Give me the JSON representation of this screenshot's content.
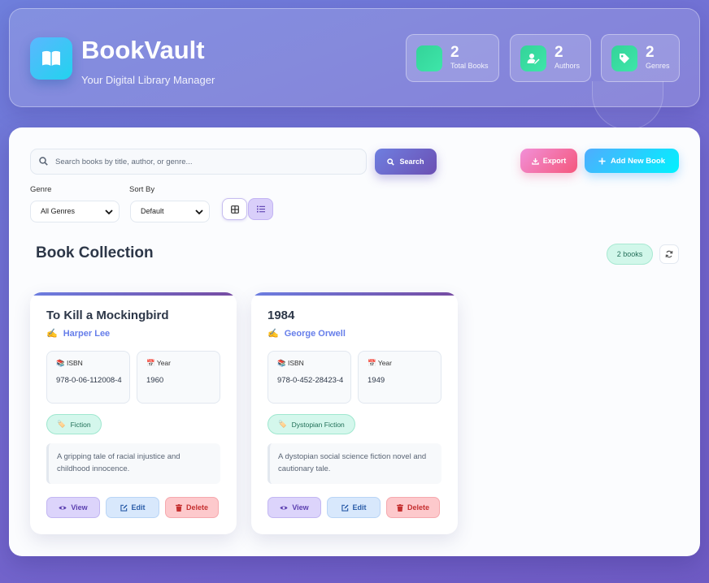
{
  "header": {
    "title": "BookVault",
    "subtitle": "Your Digital Library Manager",
    "stats": [
      {
        "value": "2",
        "label": "Total Books",
        "icon": "blank-icon"
      },
      {
        "value": "2",
        "label": "Authors",
        "icon": "user-edit-icon"
      },
      {
        "value": "2",
        "label": "Genres",
        "icon": "tag-icon"
      }
    ]
  },
  "toolbar": {
    "search_placeholder": "Search books by title, author, or genre...",
    "search_label": "Search",
    "export_label": "Export",
    "add_label": "Add New Book"
  },
  "filters": {
    "genre_label": "Genre",
    "genre_value": "All Genres",
    "sort_label": "Sort By",
    "sort_value": "Default"
  },
  "collection": {
    "title": "Book Collection",
    "count": "2 books"
  },
  "books": [
    {
      "title": "To Kill a Mockingbird",
      "author": "Harper Lee",
      "isbn_label": "ISBN",
      "isbn": "978-0-06-112008-4",
      "year_label": "Year",
      "year": "1960",
      "genre": "Fiction",
      "description": "A gripping tale of racial injustice and childhood innocence.",
      "view_label": "View",
      "edit_label": "Edit",
      "delete_label": "Delete"
    },
    {
      "title": "1984",
      "author": "George Orwell",
      "isbn_label": "ISBN",
      "isbn": "978-0-452-28423-4",
      "year_label": "Year",
      "year": "1949",
      "genre": "Dystopian Fiction",
      "description": "A dystopian social science fiction novel and cautionary tale.",
      "view_label": "View",
      "edit_label": "Edit",
      "delete_label": "Delete"
    }
  ],
  "colors": {
    "accent": "#667eea",
    "accent_dark": "#764ba2",
    "success": "#34d399",
    "danger": "#f5576c",
    "info": "#4facfe"
  }
}
